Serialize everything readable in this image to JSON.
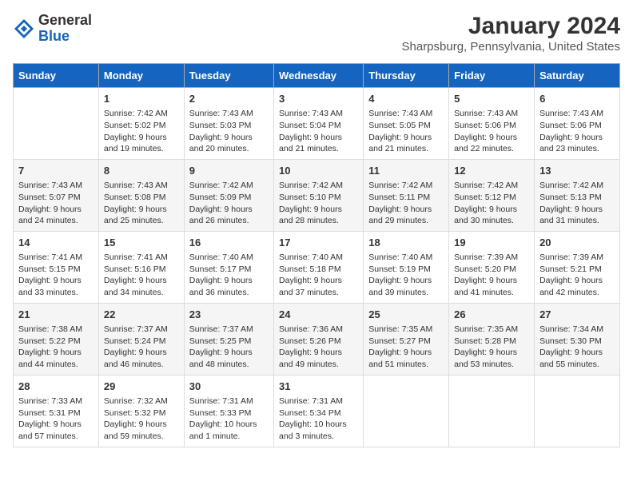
{
  "header": {
    "logo_line1": "General",
    "logo_line2": "Blue",
    "main_title": "January 2024",
    "subtitle": "Sharpsburg, Pennsylvania, United States"
  },
  "calendar": {
    "weekdays": [
      "Sunday",
      "Monday",
      "Tuesday",
      "Wednesday",
      "Thursday",
      "Friday",
      "Saturday"
    ],
    "weeks": [
      [
        {
          "day": "",
          "info": ""
        },
        {
          "day": "1",
          "info": "Sunrise: 7:42 AM\nSunset: 5:02 PM\nDaylight: 9 hours\nand 19 minutes."
        },
        {
          "day": "2",
          "info": "Sunrise: 7:43 AM\nSunset: 5:03 PM\nDaylight: 9 hours\nand 20 minutes."
        },
        {
          "day": "3",
          "info": "Sunrise: 7:43 AM\nSunset: 5:04 PM\nDaylight: 9 hours\nand 21 minutes."
        },
        {
          "day": "4",
          "info": "Sunrise: 7:43 AM\nSunset: 5:05 PM\nDaylight: 9 hours\nand 21 minutes."
        },
        {
          "day": "5",
          "info": "Sunrise: 7:43 AM\nSunset: 5:06 PM\nDaylight: 9 hours\nand 22 minutes."
        },
        {
          "day": "6",
          "info": "Sunrise: 7:43 AM\nSunset: 5:06 PM\nDaylight: 9 hours\nand 23 minutes."
        }
      ],
      [
        {
          "day": "7",
          "info": "Sunrise: 7:43 AM\nSunset: 5:07 PM\nDaylight: 9 hours\nand 24 minutes."
        },
        {
          "day": "8",
          "info": "Sunrise: 7:43 AM\nSunset: 5:08 PM\nDaylight: 9 hours\nand 25 minutes."
        },
        {
          "day": "9",
          "info": "Sunrise: 7:42 AM\nSunset: 5:09 PM\nDaylight: 9 hours\nand 26 minutes."
        },
        {
          "day": "10",
          "info": "Sunrise: 7:42 AM\nSunset: 5:10 PM\nDaylight: 9 hours\nand 28 minutes."
        },
        {
          "day": "11",
          "info": "Sunrise: 7:42 AM\nSunset: 5:11 PM\nDaylight: 9 hours\nand 29 minutes."
        },
        {
          "day": "12",
          "info": "Sunrise: 7:42 AM\nSunset: 5:12 PM\nDaylight: 9 hours\nand 30 minutes."
        },
        {
          "day": "13",
          "info": "Sunrise: 7:42 AM\nSunset: 5:13 PM\nDaylight: 9 hours\nand 31 minutes."
        }
      ],
      [
        {
          "day": "14",
          "info": "Sunrise: 7:41 AM\nSunset: 5:15 PM\nDaylight: 9 hours\nand 33 minutes."
        },
        {
          "day": "15",
          "info": "Sunrise: 7:41 AM\nSunset: 5:16 PM\nDaylight: 9 hours\nand 34 minutes."
        },
        {
          "day": "16",
          "info": "Sunrise: 7:40 AM\nSunset: 5:17 PM\nDaylight: 9 hours\nand 36 minutes."
        },
        {
          "day": "17",
          "info": "Sunrise: 7:40 AM\nSunset: 5:18 PM\nDaylight: 9 hours\nand 37 minutes."
        },
        {
          "day": "18",
          "info": "Sunrise: 7:40 AM\nSunset: 5:19 PM\nDaylight: 9 hours\nand 39 minutes."
        },
        {
          "day": "19",
          "info": "Sunrise: 7:39 AM\nSunset: 5:20 PM\nDaylight: 9 hours\nand 41 minutes."
        },
        {
          "day": "20",
          "info": "Sunrise: 7:39 AM\nSunset: 5:21 PM\nDaylight: 9 hours\nand 42 minutes."
        }
      ],
      [
        {
          "day": "21",
          "info": "Sunrise: 7:38 AM\nSunset: 5:22 PM\nDaylight: 9 hours\nand 44 minutes."
        },
        {
          "day": "22",
          "info": "Sunrise: 7:37 AM\nSunset: 5:24 PM\nDaylight: 9 hours\nand 46 minutes."
        },
        {
          "day": "23",
          "info": "Sunrise: 7:37 AM\nSunset: 5:25 PM\nDaylight: 9 hours\nand 48 minutes."
        },
        {
          "day": "24",
          "info": "Sunrise: 7:36 AM\nSunset: 5:26 PM\nDaylight: 9 hours\nand 49 minutes."
        },
        {
          "day": "25",
          "info": "Sunrise: 7:35 AM\nSunset: 5:27 PM\nDaylight: 9 hours\nand 51 minutes."
        },
        {
          "day": "26",
          "info": "Sunrise: 7:35 AM\nSunset: 5:28 PM\nDaylight: 9 hours\nand 53 minutes."
        },
        {
          "day": "27",
          "info": "Sunrise: 7:34 AM\nSunset: 5:30 PM\nDaylight: 9 hours\nand 55 minutes."
        }
      ],
      [
        {
          "day": "28",
          "info": "Sunrise: 7:33 AM\nSunset: 5:31 PM\nDaylight: 9 hours\nand 57 minutes."
        },
        {
          "day": "29",
          "info": "Sunrise: 7:32 AM\nSunset: 5:32 PM\nDaylight: 9 hours\nand 59 minutes."
        },
        {
          "day": "30",
          "info": "Sunrise: 7:31 AM\nSunset: 5:33 PM\nDaylight: 10 hours\nand 1 minute."
        },
        {
          "day": "31",
          "info": "Sunrise: 7:31 AM\nSunset: 5:34 PM\nDaylight: 10 hours\nand 3 minutes."
        },
        {
          "day": "",
          "info": ""
        },
        {
          "day": "",
          "info": ""
        },
        {
          "day": "",
          "info": ""
        }
      ]
    ]
  }
}
